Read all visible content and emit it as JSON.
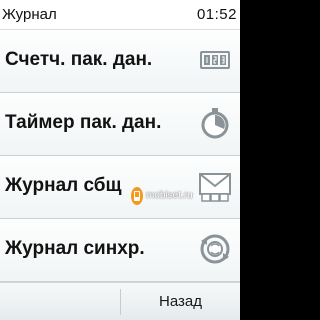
{
  "status_bar": {
    "title": "Журнал",
    "time": "01:52"
  },
  "menu": {
    "items": [
      {
        "label": "Счетч. пак. дан.",
        "icon": "counter-icon"
      },
      {
        "label": "Таймер пак. дан.",
        "icon": "timer-icon"
      },
      {
        "label": "Журнал сбщ",
        "icon": "messages-log-icon"
      },
      {
        "label": "Журнал синхр.",
        "icon": "sync-log-icon"
      }
    ]
  },
  "softkeys": {
    "left_label": "",
    "right_label": "Назад"
  },
  "watermark": {
    "text": "mobiset.ru"
  },
  "colors": {
    "text": "#121212",
    "background": "#f1f5f6",
    "divider": "#c9d2d6",
    "icon_gray": "#8a9498"
  }
}
